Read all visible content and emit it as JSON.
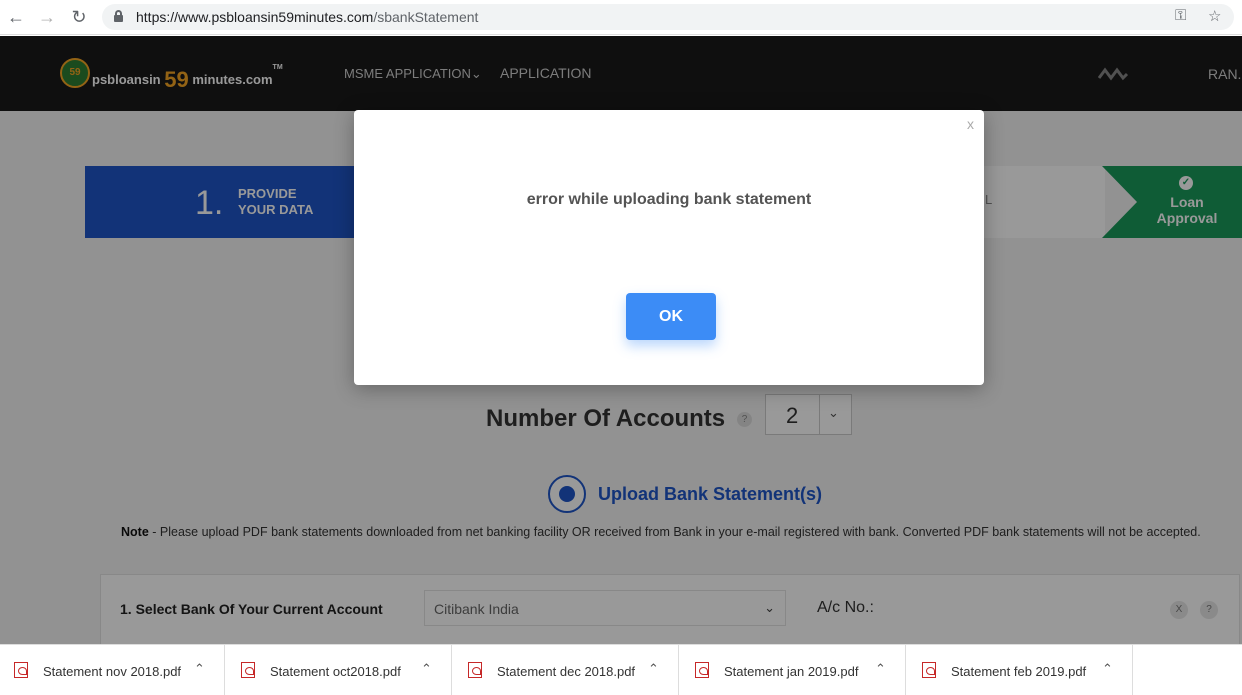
{
  "browser": {
    "url_host": "https://www.psbloansin59minutes.com",
    "url_path": "/sbankStatement"
  },
  "header": {
    "logo_badge": "59",
    "logo_left": "psbloansin",
    "logo_num": "59",
    "logo_right": "minutes.com",
    "logo_tm": "TM",
    "nav_msme": "MSME APPLICATION",
    "nav_application": "APPLICATION",
    "user": "RAN."
  },
  "stepper": {
    "step1_num": "1.",
    "step1_line1": "PROVIDE",
    "step1_line2": "YOUR DATA",
    "mid_fragment": "L",
    "last_line1": "Loan",
    "last_line2": "Approval"
  },
  "accounts": {
    "label": "Number Of Accounts",
    "help": "?",
    "value": "2"
  },
  "upload": {
    "label": "Upload Bank Statement(s)"
  },
  "note": {
    "prefix": "Note",
    "text": " - Please upload PDF bank statements downloaded from net banking facility OR received from Bank in your e-mail registered with bank. Converted PDF bank statements will not be accepted."
  },
  "bank_row": {
    "label": "1. Select Bank Of Your Current Account",
    "selected_bank": "Citibank India",
    "acno_label": "A/c No.:",
    "remove": "X",
    "help": "?"
  },
  "modal": {
    "close": "x",
    "message": "error while uploading bank statement",
    "ok_label": "OK"
  },
  "downloads": [
    {
      "name": "Statement nov 2018.pdf"
    },
    {
      "name": "Statement oct2018.pdf"
    },
    {
      "name": "Statement dec 2018.pdf"
    },
    {
      "name": "Statement jan 2019.pdf"
    },
    {
      "name": "Statement feb 2019.pdf"
    }
  ],
  "colors": {
    "brand_blue": "#1e56c8",
    "approval_green": "#1a9a5b",
    "ok_button": "#3c8cf6",
    "header_bg": "#1a1a1a"
  }
}
